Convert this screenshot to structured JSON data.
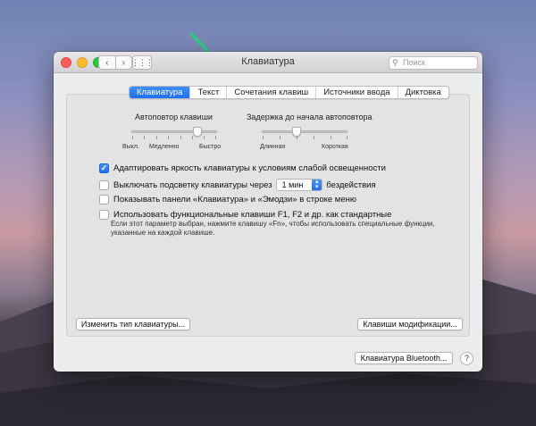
{
  "window": {
    "title": "Клавиатура",
    "search_placeholder": "Поиск",
    "nav_back": "‹",
    "nav_forward": "›",
    "grid_icon": "⋮⋮⋮"
  },
  "tabs": [
    {
      "label": "Клавиатура",
      "active": true
    },
    {
      "label": "Текст",
      "active": false
    },
    {
      "label": "Сочетания клавиш",
      "active": false
    },
    {
      "label": "Источники ввода",
      "active": false
    },
    {
      "label": "Диктовка",
      "active": false
    }
  ],
  "repeat_slider": {
    "label": "Автоповтор клавиши",
    "ticks": [
      "Выкл.",
      "Медленно",
      "Быстро"
    ],
    "level": 0.85
  },
  "delay_slider": {
    "label": "Задержка до начала автоповтора",
    "ticks": [
      "Длинная",
      "Короткая"
    ],
    "level": 0.4
  },
  "options": {
    "brightness": {
      "label": "Адаптировать яркость клавиатуры к условиям слабой освещенности",
      "checked": true
    },
    "backlight": {
      "label": "Выключать подсветку клавиатуры через",
      "checked": false,
      "select_value": "1 мин",
      "suffix": "бездействия"
    },
    "show_panels": {
      "label": "Показывать панели «Клавиатура» и «Эмодзи» в строке меню",
      "checked": false
    },
    "fn_keys": {
      "label": "Использовать функциональные клавиши F1, F2 и др. как стандартные",
      "checked": false
    },
    "fn_note": "Если этот параметр выбран, нажмите клавишу «Fn», чтобы использовать специальные функции, указанные на каждой клавише."
  },
  "buttons": {
    "change_type": "Изменить тип клавиатуры...",
    "modifiers": "Клавиши модификации...",
    "bluetooth": "Клавиатура Bluetooth...",
    "help": "?"
  },
  "colors": {
    "accent": "#1e6ff0",
    "arrow": "#3cc48a"
  }
}
